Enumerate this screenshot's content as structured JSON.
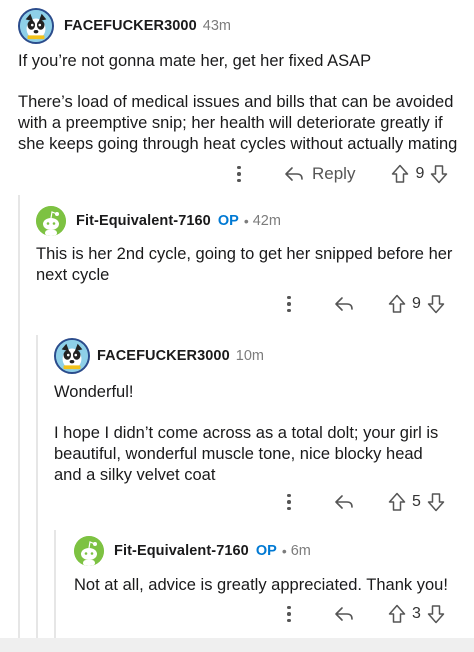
{
  "comments": [
    {
      "username": "FACEFUCKER3000",
      "time": "43m",
      "paragraphs": [
        "If you’re not gonna mate her, get her fixed ASAP",
        "There’s load of medical issues and bills that can be avoided with a preemptive snip; her health will deteriorate greatly if she keeps going through heat cycles without actually mating"
      ],
      "reply_label": "Reply",
      "votes": "9"
    },
    {
      "username": "Fit-Equivalent-7160",
      "op_badge": "OP",
      "separator": "•",
      "time": "42m",
      "paragraphs": [
        "This is her 2nd cycle, going to get her snipped before her next cycle"
      ],
      "votes": "9"
    },
    {
      "username": "FACEFUCKER3000",
      "time": "10m",
      "paragraphs": [
        "Wonderful!",
        "I hope I didn’t come across as a total dolt; your girl is beautiful, wonderful muscle tone, nice blocky head and a silky velvet coat"
      ],
      "votes": "5"
    },
    {
      "username": "Fit-Equivalent-7160",
      "op_badge": "OP",
      "separator": "•",
      "time": "6m",
      "paragraphs": [
        "Not at all, advice is greatly appreciated. Thank you!"
      ],
      "votes": "3"
    }
  ],
  "icons": {
    "more": "more-vertical-icon",
    "reply": "reply-arrow-icon",
    "upvote": "upvote-arrow-icon",
    "downvote": "downvote-arrow-icon",
    "avatar_dog": "dog-avatar",
    "avatar_snoo": "snoo-avatar"
  },
  "colors": {
    "op_badge": "#0079d3",
    "meta_gray": "#7c7c7c",
    "snoo_green": "#7dc242",
    "thread_line": "#e6e6e6"
  }
}
